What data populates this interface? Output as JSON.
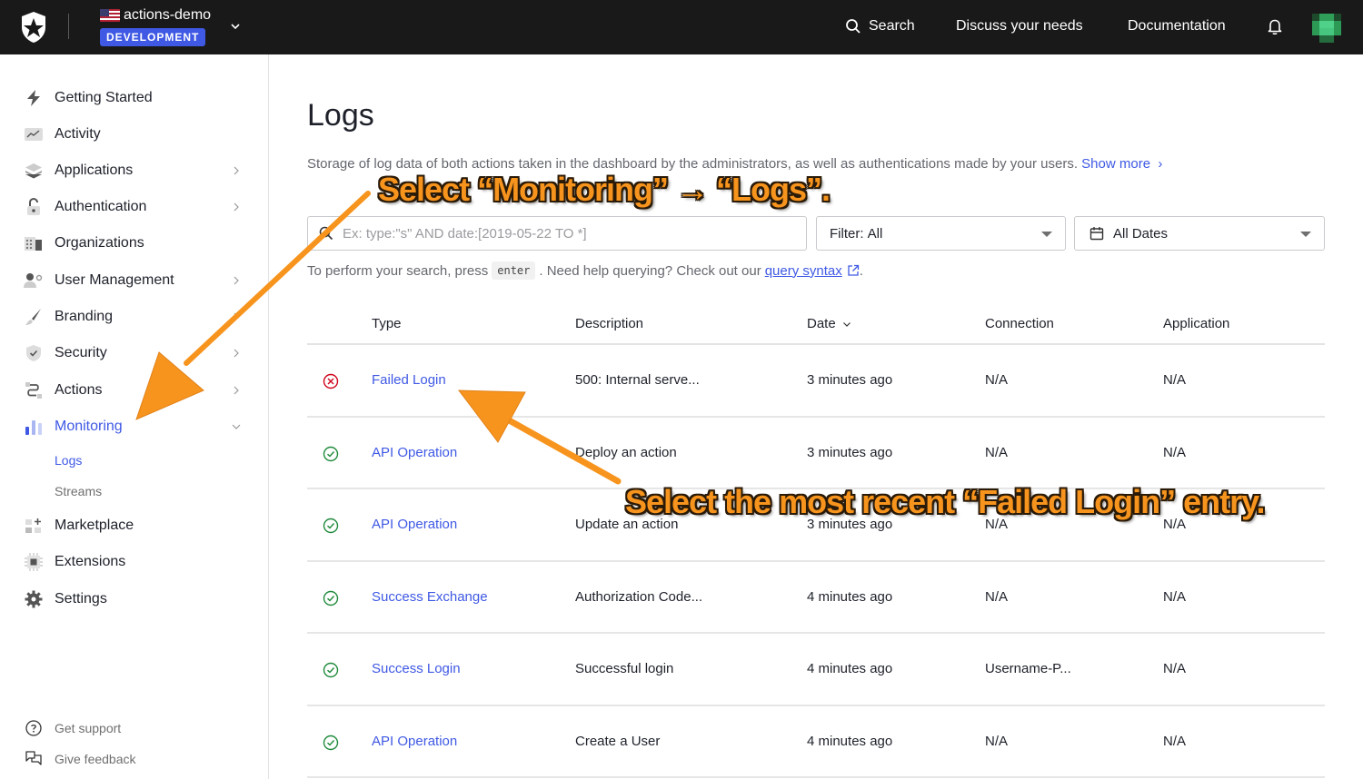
{
  "topbar": {
    "tenant_name": "actions-demo",
    "environment_badge": "DEVELOPMENT",
    "search_label": "Search",
    "discuss_label": "Discuss your needs",
    "docs_label": "Documentation"
  },
  "sidebar": {
    "items": [
      {
        "label": "Getting Started",
        "icon": "bolt-icon",
        "has_chevron": false
      },
      {
        "label": "Activity",
        "icon": "activity-chart-icon",
        "has_chevron": false
      },
      {
        "label": "Applications",
        "icon": "layers-icon",
        "has_chevron": true
      },
      {
        "label": "Authentication",
        "icon": "lock-icon",
        "has_chevron": true
      },
      {
        "label": "Organizations",
        "icon": "building-icon",
        "has_chevron": false
      },
      {
        "label": "User Management",
        "icon": "user-gear-icon",
        "has_chevron": true
      },
      {
        "label": "Branding",
        "icon": "brush-icon",
        "has_chevron": true
      },
      {
        "label": "Security",
        "icon": "shield-check-icon",
        "has_chevron": true
      },
      {
        "label": "Actions",
        "icon": "flow-icon",
        "has_chevron": true
      },
      {
        "label": "Monitoring",
        "icon": "bar-chart-icon",
        "has_chevron": true,
        "expanded": true,
        "active": true
      },
      {
        "label": "Marketplace",
        "icon": "grid-plus-icon",
        "has_chevron": false
      },
      {
        "label": "Extensions",
        "icon": "chip-icon",
        "has_chevron": false
      },
      {
        "label": "Settings",
        "icon": "gear-icon",
        "has_chevron": false
      }
    ],
    "sub_items": [
      {
        "label": "Logs",
        "active": true
      },
      {
        "label": "Streams",
        "active": false
      }
    ],
    "footer": {
      "support_label": "Get support",
      "feedback_label": "Give feedback"
    }
  },
  "main": {
    "title": "Logs",
    "description": "Storage of log data of both actions taken in the dashboard by the administrators, as well as authentications made by your users.",
    "show_more_label": "Show more",
    "search_placeholder": "Ex: type:\"s\" AND date:[2019-05-22 TO *]",
    "search_value": "",
    "filter_label": "Filter:",
    "filter_value": "All",
    "date_value": "All Dates",
    "help_prefix": "To perform your search, press",
    "help_key": "enter",
    "help_middle": ". Need help querying? Check out our",
    "help_link": "query syntax",
    "help_suffix": ".",
    "table": {
      "columns": [
        "Type",
        "Description",
        "Date",
        "Connection",
        "Application"
      ],
      "sorted_column": "Date",
      "rows": [
        {
          "status": "error",
          "type": "Failed Login",
          "description": "500: Internal serve...",
          "date": "3 minutes ago",
          "connection": "N/A",
          "application": "N/A"
        },
        {
          "status": "success",
          "type": "API Operation",
          "description": "Deploy an action",
          "date": "3 minutes ago",
          "connection": "N/A",
          "application": "N/A"
        },
        {
          "status": "success",
          "type": "API Operation",
          "description": "Update an action",
          "date": "3 minutes ago",
          "connection": "N/A",
          "application": "N/A"
        },
        {
          "status": "success",
          "type": "Success Exchange",
          "description": "Authorization Code...",
          "date": "4 minutes ago",
          "connection": "N/A",
          "application": "N/A"
        },
        {
          "status": "success",
          "type": "Success Login",
          "description": "Successful login",
          "date": "4 minutes ago",
          "connection": "Username-P...",
          "application": "N/A"
        },
        {
          "status": "success",
          "type": "API Operation",
          "description": "Create a User",
          "date": "4 minutes ago",
          "connection": "N/A",
          "application": "N/A"
        }
      ]
    }
  },
  "annotations": {
    "step1": "Select “Monitoring” → “Logs”.",
    "step2": "Select the most recent “Failed Login” entry."
  },
  "colors": {
    "accent": "#3f59e4",
    "topbar_bg": "#191919",
    "error": "#d0021b",
    "success": "#1f8a3b",
    "annotation": "#f7941d"
  }
}
